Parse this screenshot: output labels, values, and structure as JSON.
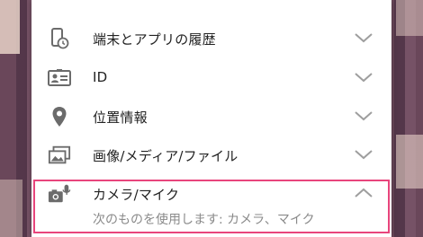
{
  "permissions": {
    "items": [
      {
        "label": "端末とアプリの履歴",
        "icon": "device-history-icon",
        "expanded": false
      },
      {
        "label": "ID",
        "icon": "id-card-icon",
        "expanded": false
      },
      {
        "label": "位置情報",
        "icon": "location-pin-icon",
        "expanded": false
      },
      {
        "label": "画像/メディア/ファイル",
        "icon": "photos-icon",
        "expanded": false
      },
      {
        "label": "カメラ/マイク",
        "icon": "camera-mic-icon",
        "expanded": true
      }
    ],
    "camera_detail": "次のものを使用します: カメラ、マイク"
  },
  "colors": {
    "highlight": "#e8457c",
    "icon": "#6b6b6b",
    "chevron": "#9e9e9e",
    "text": "#222222",
    "subtext": "#8a8a8a"
  }
}
